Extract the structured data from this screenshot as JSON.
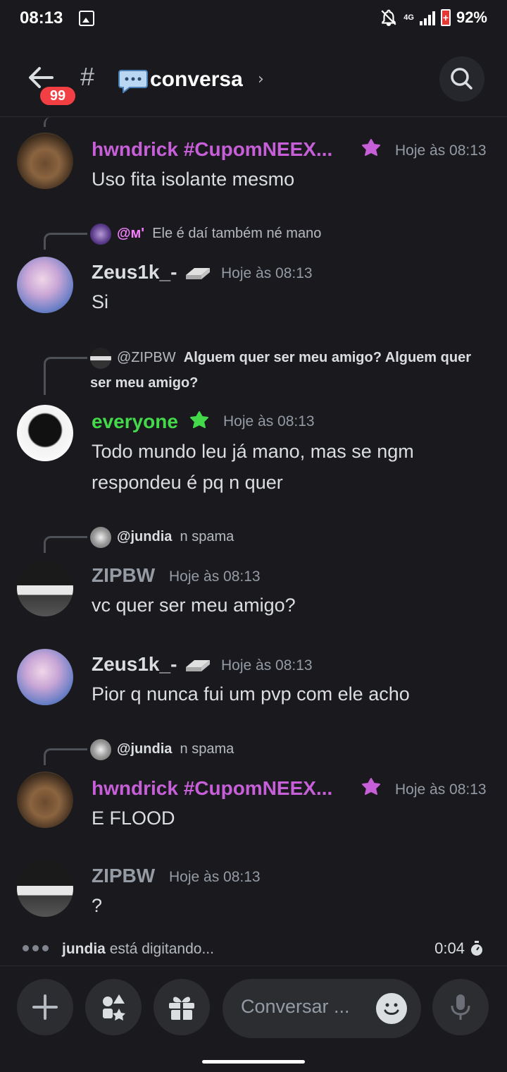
{
  "status_bar": {
    "time": "08:13",
    "network": "4G",
    "battery": "92%"
  },
  "header": {
    "unread_badge": "99",
    "channel_prefix": "#",
    "channel_name": "conversa",
    "chevron": "›"
  },
  "messages": [
    {
      "username": "hwndrick #CupomNEEX...",
      "timestamp": "Hoje às 08:13",
      "text": "Uso fita isolante mesmo",
      "name_color": "#c75fd9"
    },
    {
      "reply_to": "@ᴍ'",
      "reply_text": "Ele é daí também né mano",
      "username": "Zeus1k_-",
      "timestamp": "Hoje às 08:13",
      "text": "Si"
    },
    {
      "reply_to": "@ZIPBW",
      "reply_text": "Alguem quer ser meu amigo? Alguem quer ser meu amigo?",
      "username": "everyone",
      "timestamp": "Hoje às 08:13",
      "text": "Todo mundo leu já mano, mas se ngm respondeu é pq n quer",
      "name_color": "#43d94a"
    },
    {
      "reply_to": "@jundia",
      "reply_text": "n spama",
      "username": "ZIPBW",
      "timestamp": "Hoje às 08:13",
      "text": "vc quer ser meu amigo?"
    },
    {
      "username": "Zeus1k_-",
      "timestamp": "Hoje às 08:13",
      "text": "Pior q nunca fui um pvp com ele acho"
    },
    {
      "reply_to": "@jundia",
      "reply_text": "n spama",
      "username": "hwndrick #CupomNEEX...",
      "timestamp": "Hoje às 08:13",
      "text": "E FLOOD",
      "name_color": "#c75fd9"
    },
    {
      "username": "ZIPBW",
      "timestamp": "Hoje às 08:13",
      "text": "?"
    }
  ],
  "typing": {
    "user": "jundia",
    "text": "está digitando...",
    "timer": "0:04"
  },
  "composer": {
    "placeholder": "Conversar ..."
  }
}
